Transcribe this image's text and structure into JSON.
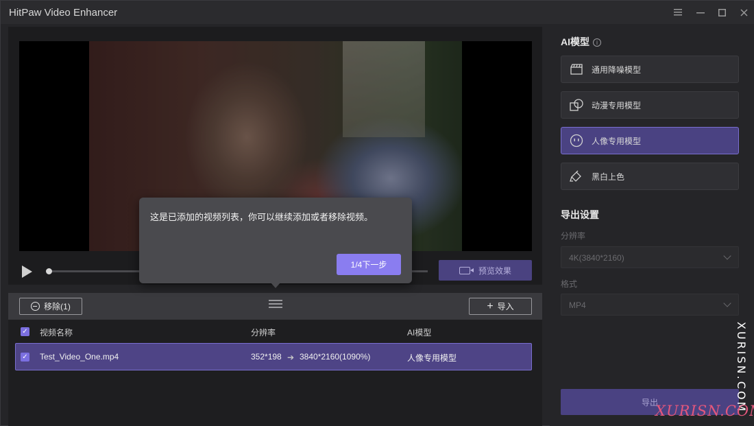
{
  "window": {
    "title": "HitPaw Video Enhancer",
    "controls": [
      "menu-icon",
      "minimize-icon",
      "maximize-icon",
      "close-icon"
    ]
  },
  "player": {
    "play_icon": "play-icon",
    "progress": 0.0,
    "preview_label": "预览效果",
    "preview_icon": "video-camera-icon"
  },
  "tooltip": {
    "message": "这是已添加的视频列表，你可以继续添加或者移除视频。",
    "next_label": "1/4下一步"
  },
  "list": {
    "remove_label": "移除(1)",
    "import_label": "导入",
    "headers": {
      "name": "视频名称",
      "resolution": "分辨率",
      "model": "AI模型"
    },
    "rows": [
      {
        "checked": true,
        "name": "Test_Video_One.mp4",
        "res_from": "352*198",
        "res_to": "3840*2160(1090%)",
        "model": "人像专用模型"
      }
    ]
  },
  "sidebar": {
    "ai_title": "AI模型",
    "models": [
      {
        "label": "通用降噪模型",
        "icon": "clapperboard-icon",
        "selected": false
      },
      {
        "label": "动漫专用模型",
        "icon": "anime-icon",
        "selected": false
      },
      {
        "label": "人像专用模型",
        "icon": "face-icon",
        "selected": true
      },
      {
        "label": "黑白上色",
        "icon": "paint-bucket-icon",
        "selected": false
      }
    ],
    "export_title": "导出设置",
    "resolution_label": "分辨率",
    "resolution_value": "4K(3840*2160)",
    "format_label": "格式",
    "format_value": "MP4",
    "export_label": "导出"
  },
  "watermark": {
    "vertical": "XURISN.COM",
    "horizontal": "XURISN.COM"
  },
  "colors": {
    "accent": "#8a7df0",
    "selected": "#4a4282",
    "bg": "#252528"
  }
}
